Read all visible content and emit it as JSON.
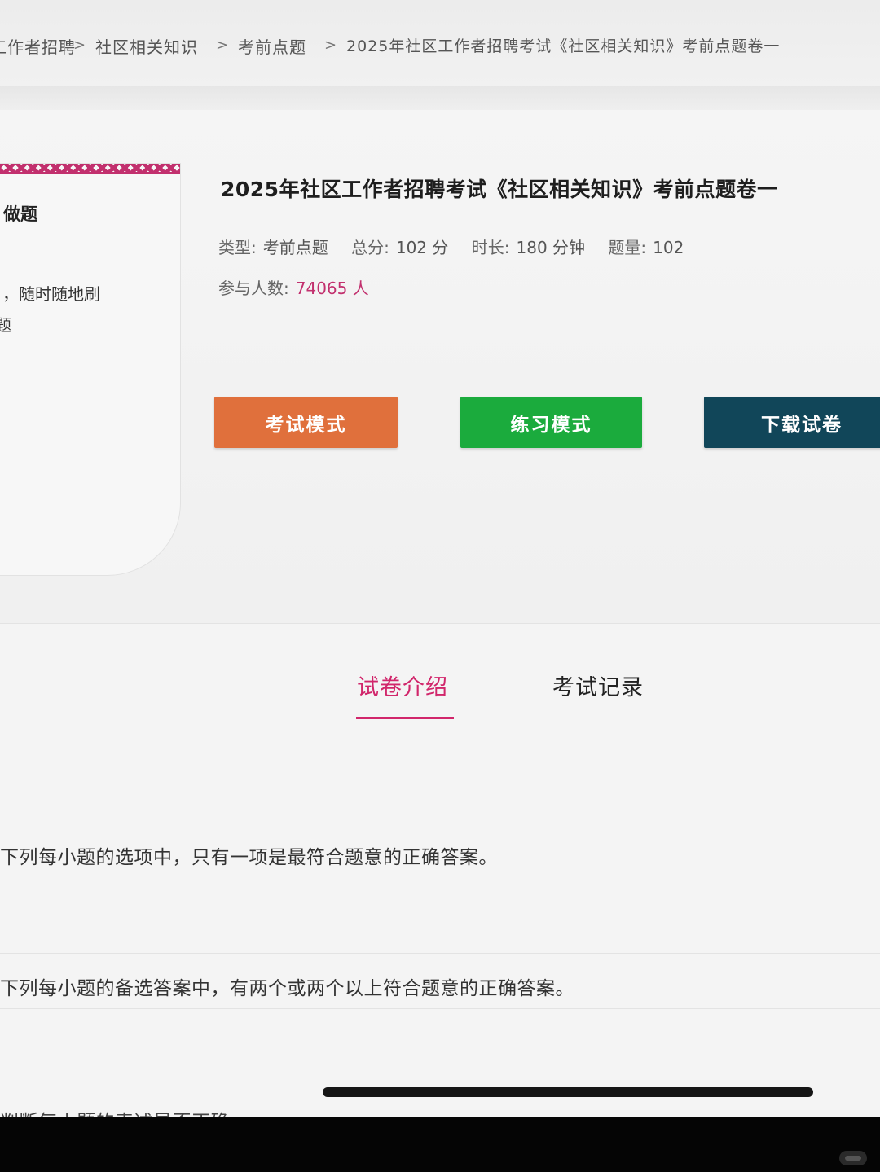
{
  "breadcrumb": {
    "items": [
      "工作者招聘",
      "社区相关知识",
      "考前点题",
      "2025年社区工作者招聘考试《社区相关知识》考前点题卷一"
    ],
    "separator": ">"
  },
  "promo": {
    "title": "做题",
    "line1": "，随时随地刷",
    "line2": "题"
  },
  "paper": {
    "title": "2025年社区工作者招聘考试《社区相关知识》考前点题卷一",
    "type_label": "类型:",
    "type_value": "考前点题",
    "score_label": "总分:",
    "score_value": "102 分",
    "duration_label": "时长:",
    "duration_value": "180 分钟",
    "count_label": "题量:",
    "count_value": "102",
    "participants_label": "参与人数:",
    "participants_value": "74065 人"
  },
  "actions": {
    "exam_mode": "考试模式",
    "practice_mode": "练习模式",
    "download": "下载试卷"
  },
  "tabs": {
    "intro": "试卷介绍",
    "record": "考试记录"
  },
  "rules": {
    "single": "下列每小题的选项中，只有一项是最符合题意的正确答案。",
    "multiple": "下列每小题的备选答案中，有两个或两个以上符合题意的正确答案。",
    "judge": "判断每小题的表述是否正确"
  },
  "colors": {
    "accent_pink": "#d1266b",
    "exam_button": "#e0703c",
    "practice_button": "#1bab3d",
    "download_button": "#114659"
  }
}
